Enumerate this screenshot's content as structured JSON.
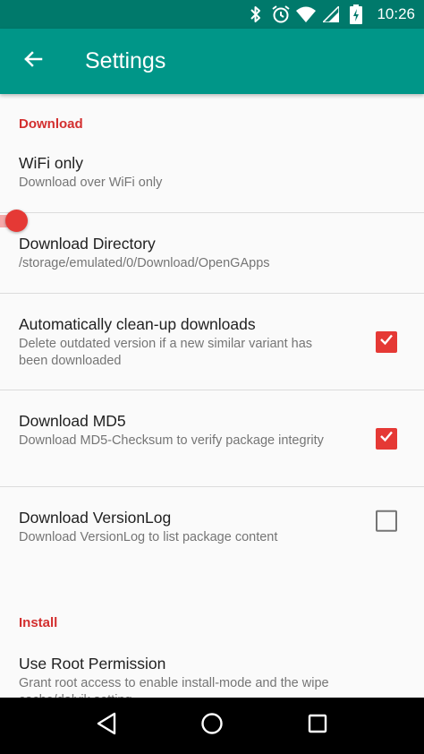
{
  "status_bar": {
    "time": "10:26",
    "icons": [
      "bluetooth-icon",
      "alarm-icon",
      "wifi-icon",
      "signal-icon",
      "battery-charging-icon"
    ]
  },
  "app_bar": {
    "title": "Settings",
    "back_icon": "arrow-left-icon"
  },
  "categories": {
    "download": "Download",
    "install": "Install"
  },
  "prefs": {
    "wifi_only": {
      "title": "WiFi only",
      "summary": "Download over WiFi only",
      "widget": "switch",
      "checked": true
    },
    "download_directory": {
      "title": "Download Directory",
      "summary": "/storage/emulated/0/Download/OpenGApps"
    },
    "auto_cleanup": {
      "title": "Automatically clean-up downloads",
      "summary": "Delete outdated version if a new similar variant has been downloaded",
      "widget": "checkbox",
      "checked": true
    },
    "download_md5": {
      "title": "Download MD5",
      "summary": "Download MD5-Checksum to verify package integrity",
      "widget": "checkbox",
      "checked": true
    },
    "download_versionlog": {
      "title": "Download VersionLog",
      "summary": "Download VersionLog to list package content",
      "widget": "checkbox",
      "checked": false
    },
    "root_permission": {
      "title": "Use Root Permission",
      "summary": "Grant root access to enable install-mode and the wipe cache/dalvik setting",
      "widget": "switch",
      "checked": false
    }
  },
  "nav_bar": {
    "icons": [
      "back-triangle-icon",
      "home-circle-icon",
      "recents-square-icon"
    ]
  },
  "colors": {
    "status_bar": "#00796b",
    "app_bar": "#009688",
    "accent": "#e53935",
    "category_text": "#d32f2f"
  }
}
